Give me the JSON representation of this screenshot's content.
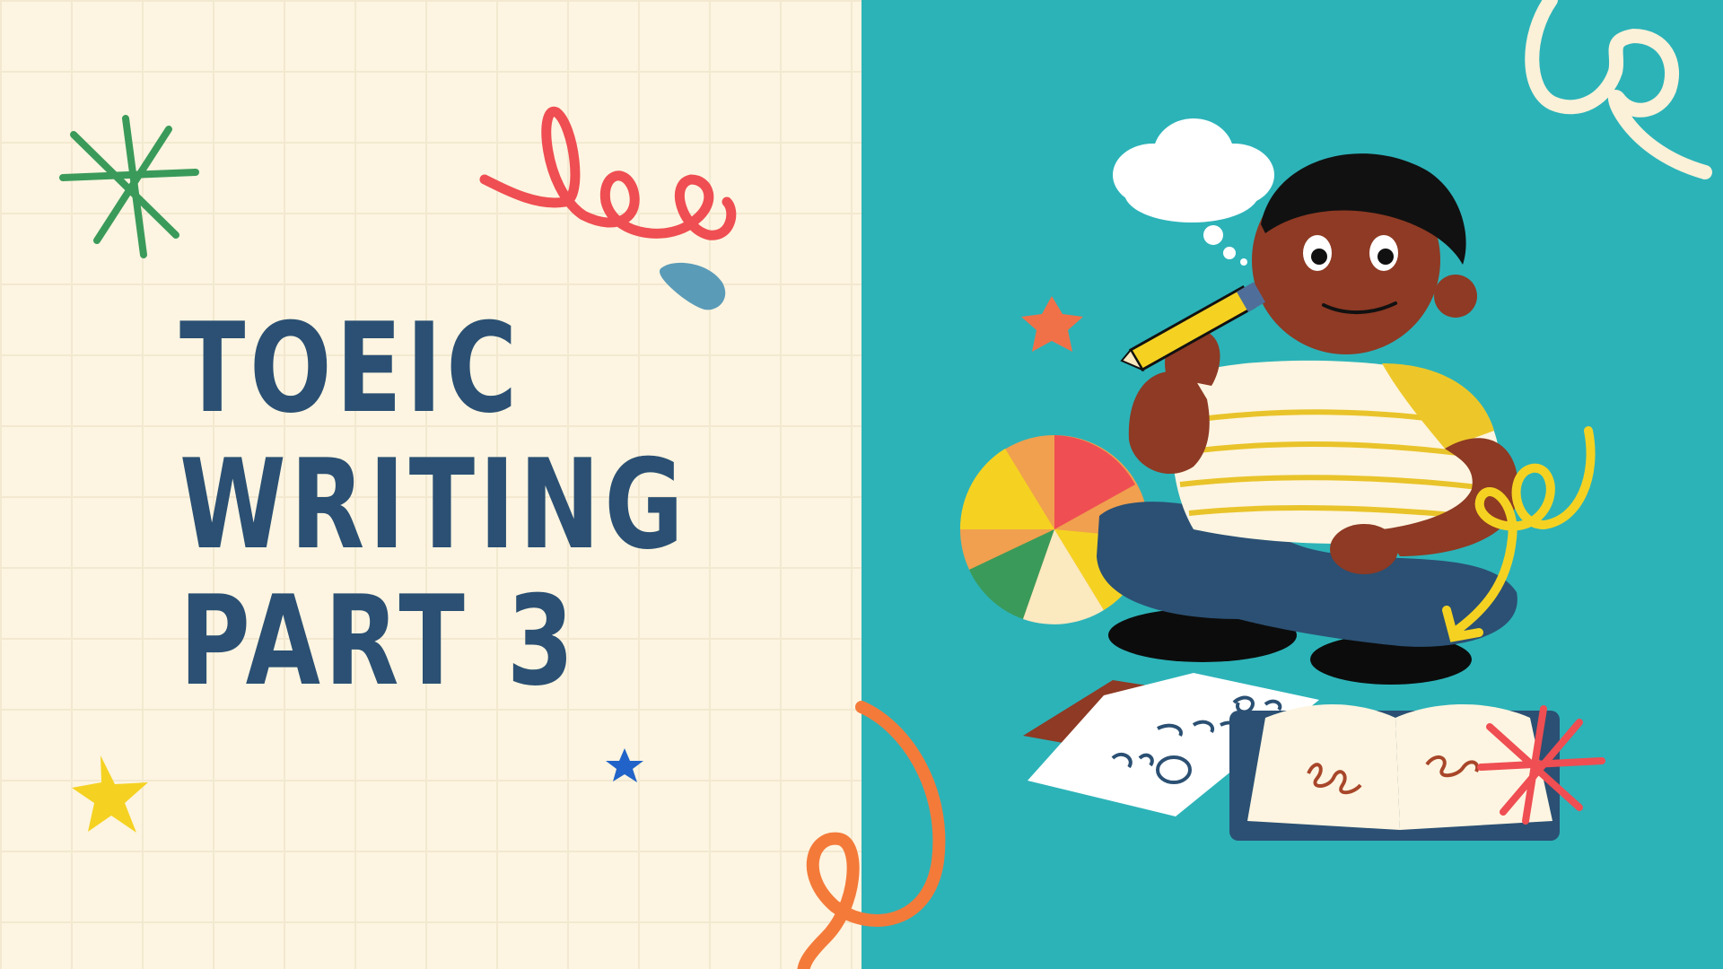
{
  "slide": {
    "title_lines": [
      "TOEIC",
      "WRITING",
      "PART 3"
    ]
  },
  "colors": {
    "left_background": "#fdf5e1",
    "right_background": "#2cb3b8",
    "title": "#2b5073"
  },
  "decorations": [
    "green-asterisk-icon",
    "red-swirl-icon",
    "blue-blob-icon",
    "yellow-star-icon",
    "blue-star-icon",
    "orange-swirl-icon",
    "cream-swirl-icon",
    "orange-star-icon",
    "yellow-swirl-arrow-icon",
    "red-asterisk-icon"
  ],
  "illustration": "child-thinking-illustration"
}
